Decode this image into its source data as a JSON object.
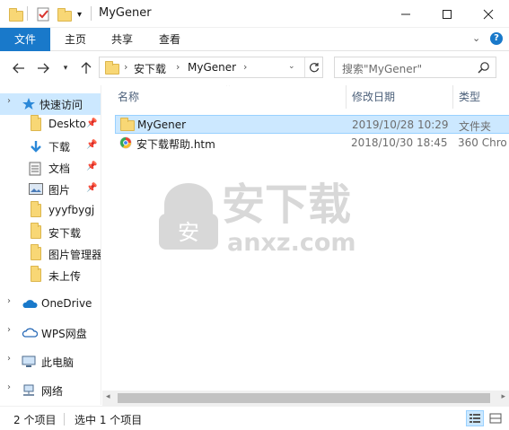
{
  "window": {
    "title": "MyGener",
    "minimize_label": "—",
    "maximize_label": "☐",
    "close_label": "✕"
  },
  "ribbon": {
    "tabs": [
      {
        "label": "文件"
      },
      {
        "label": "主页"
      },
      {
        "label": "共享"
      },
      {
        "label": "查看"
      }
    ]
  },
  "address": {
    "crumbs": [
      "安下载",
      "MyGener"
    ]
  },
  "search": {
    "placeholder": "搜索\"MyGener\""
  },
  "sidebar": {
    "items": [
      {
        "label": "快速访问",
        "icon": "star-icon"
      },
      {
        "label": "Deskto",
        "icon": "folder-icon",
        "pinned": true
      },
      {
        "label": "下载",
        "icon": "download-icon",
        "pinned": true
      },
      {
        "label": "文档",
        "icon": "document-icon",
        "pinned": true
      },
      {
        "label": "图片",
        "icon": "picture-icon",
        "pinned": true
      },
      {
        "label": "yyyfbygj",
        "icon": "folder-icon"
      },
      {
        "label": "安下载",
        "icon": "folder-icon"
      },
      {
        "label": "图片管理器",
        "icon": "folder-icon"
      },
      {
        "label": "未上传",
        "icon": "folder-icon"
      },
      {
        "label": "OneDrive",
        "icon": "cloud-icon"
      },
      {
        "label": "WPS网盘",
        "icon": "cloud-outline-icon"
      },
      {
        "label": "此电脑",
        "icon": "computer-icon"
      },
      {
        "label": "网络",
        "icon": "network-icon"
      }
    ]
  },
  "columns": {
    "name": "名称",
    "date": "修改日期",
    "type": "类型"
  },
  "files": [
    {
      "name": "MyGener",
      "date": "2019/10/28 10:29",
      "type": "文件夹",
      "icon": "folder-icon",
      "selected": true
    },
    {
      "name": "安下载帮助.htm",
      "date": "2018/10/30 18:45",
      "type": "360 Chro",
      "icon": "browser-icon",
      "selected": false
    }
  ],
  "watermark": {
    "text": "安下载",
    "domain": "anxz.com"
  },
  "status": {
    "item_count": "2 个项目",
    "selected_count": "选中 1 个项目"
  },
  "colors": {
    "accent": "#1979ca",
    "selection": "#cce8ff",
    "folder": "#f8d775"
  }
}
